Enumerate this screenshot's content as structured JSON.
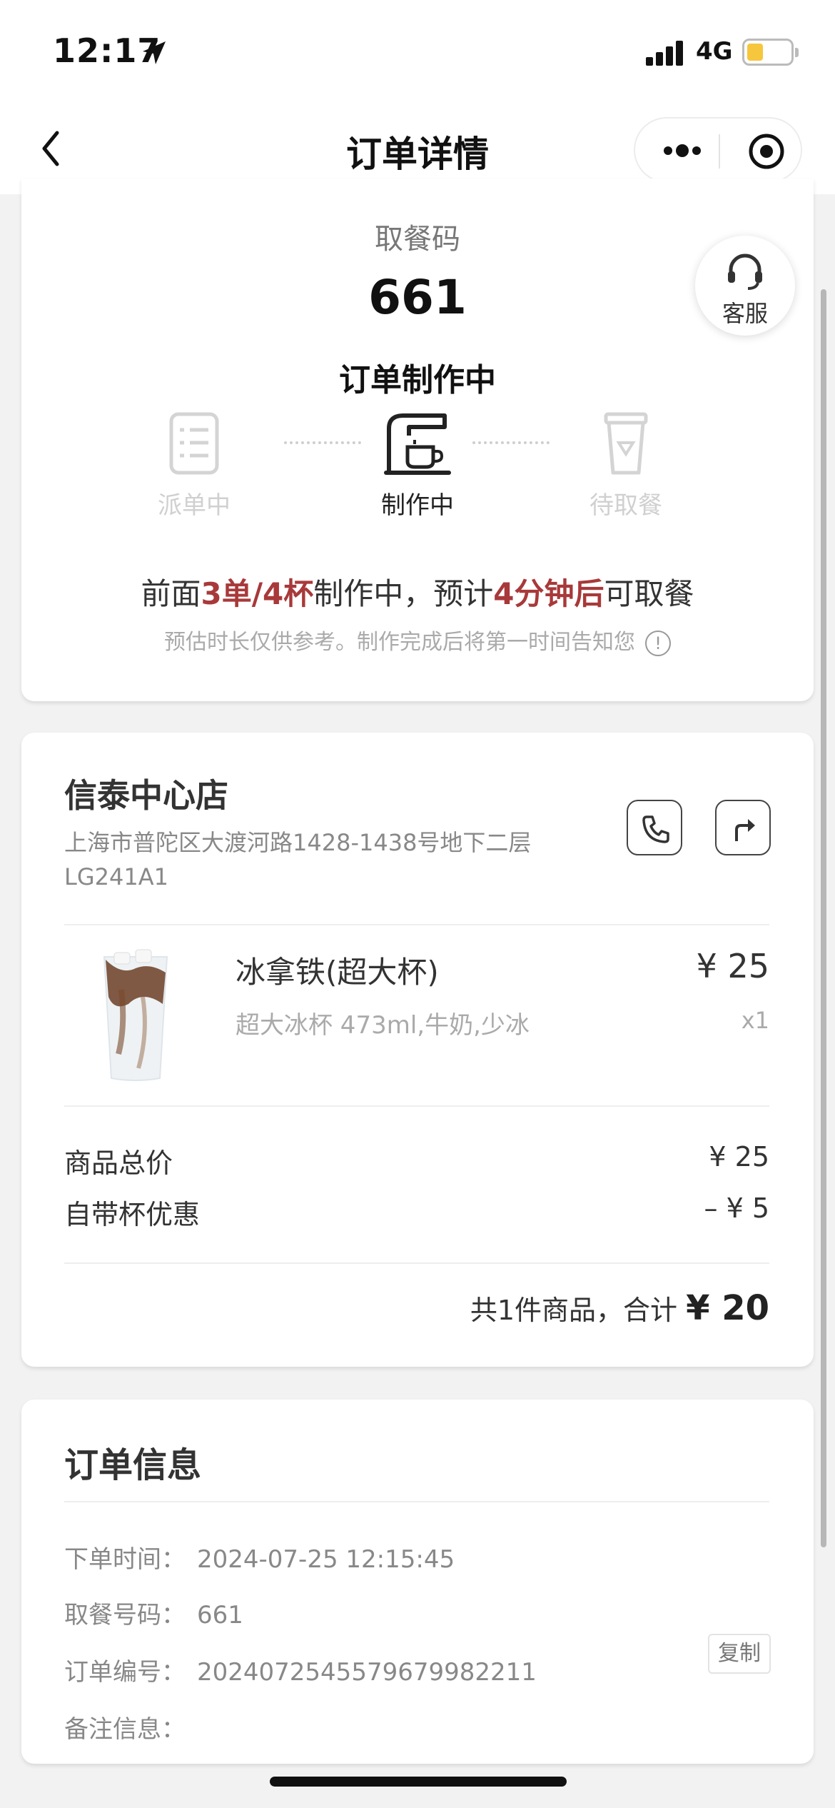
{
  "status_bar": {
    "time": "12:17",
    "network": "4G",
    "battery_color": "#f6c63c"
  },
  "nav": {
    "title": "订单详情"
  },
  "pickup": {
    "label": "取餐码",
    "code": "661",
    "status_title": "订单制作中",
    "service_label": "客服",
    "steps": [
      {
        "label": "派单中",
        "icon": "clipboard-icon",
        "active": false
      },
      {
        "label": "制作中",
        "icon": "coffee-machine-icon",
        "active": true
      },
      {
        "label": "待取餐",
        "icon": "cup-icon",
        "active": false
      }
    ],
    "queue": {
      "prefix": "前面",
      "count": "3单/4杯",
      "middle": "制作中，预计",
      "eta": "4分钟后",
      "suffix": "可取餐",
      "highlight_color": "#a8393a"
    },
    "note": "预估时长仅供参考。制作完成后将第一时间告知您",
    "note_icon": "!"
  },
  "store": {
    "name": "信泰中心店",
    "address": "上海市普陀区大渡河路1428-1438号地下二层LG241A1"
  },
  "item": {
    "name": "冰拿铁(超大杯)",
    "spec": "超大冰杯 473ml,牛奶,少冰",
    "price": "¥ 25",
    "qty": "x1"
  },
  "summary": {
    "subtotal_label": "商品总价",
    "subtotal_value": "¥ 25",
    "discount_label": "自带杯优惠",
    "discount_value": "– ¥ 5",
    "total_prefix": "共1件商品，合计",
    "total_value": "¥ 20"
  },
  "order_info": {
    "title": "订单信息",
    "rows": [
      {
        "key": "下单时间：",
        "value": "2024-07-25 12:15:45"
      },
      {
        "key": "取餐号码：",
        "value": "661"
      },
      {
        "key": "订单编号：",
        "value": "202407254557967998221​1"
      },
      {
        "key": "备注信息：",
        "value": ""
      }
    ],
    "copy_label": "复制"
  }
}
